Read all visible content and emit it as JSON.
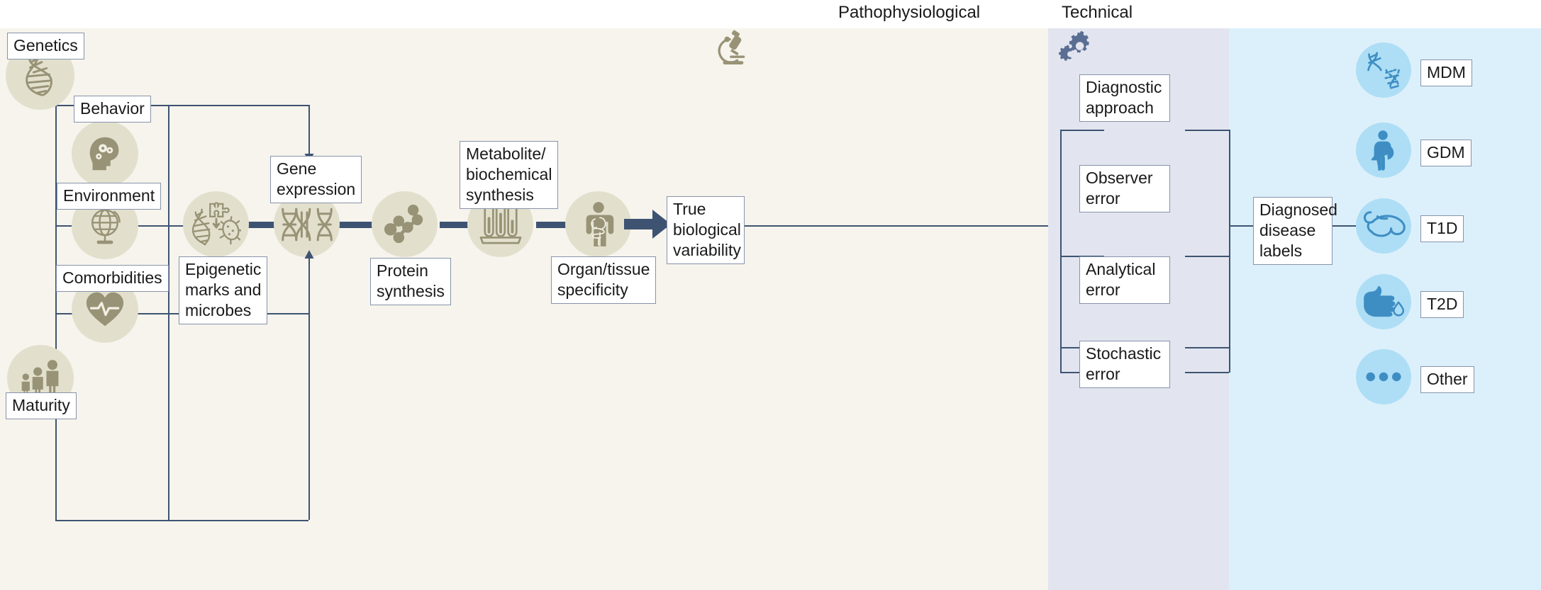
{
  "headers": {
    "pathophysiological": "Pathophysiological",
    "technical": "Technical"
  },
  "colors": {
    "panel_pathophysiological": "#f6f4ec",
    "panel_technical": "#e2e5ef",
    "panel_disease": "#dcf0fb",
    "beige_circle": "#e2e0cd",
    "beige_icon": "#989376",
    "blue_circle": "#addef5",
    "blue_icon": "#3e8ec4",
    "connector": "#3e5372",
    "box_border": "#8793ab",
    "text": "#1a1a1a"
  },
  "determinants": [
    {
      "label": "Genetics",
      "icon": "dna-helix-icon"
    },
    {
      "label": "Behavior",
      "icon": "head-gears-icon"
    },
    {
      "label": "Environment",
      "icon": "globe-icon"
    },
    {
      "label": "Comorbidities",
      "icon": "heart-pulse-icon"
    },
    {
      "label": "Maturity",
      "icon": "family-growth-icon"
    }
  ],
  "pathway": [
    {
      "label": "Epigenetic\nmarks and\nmicrobes",
      "icon": "dna-puzzle-microbe-icon"
    },
    {
      "label": "Gene\nexpression",
      "icon": "dna-double-helix-icon"
    },
    {
      "label": "Protein\nsynthesis",
      "icon": "molecule-icon"
    },
    {
      "label": "Metabolite/\nbiochemical\nsynthesis",
      "icon": "test-tubes-icon"
    },
    {
      "label": "Organ/tissue\nspecificity",
      "icon": "human-organs-icon"
    }
  ],
  "outcome": {
    "label": "True\nbiological\nvariability"
  },
  "technical": {
    "icon": "gears-icon",
    "items": [
      {
        "label": "Diagnostic\napproach"
      },
      {
        "label": "Observer\nerror"
      },
      {
        "label": "Analytical\nerror"
      },
      {
        "label": "Stochastic\nerror"
      }
    ]
  },
  "patho_icon": "microscope-icon",
  "diagnosed": {
    "label": "Diagnosed\ndisease\nlabels"
  },
  "diseases": [
    {
      "label": "MDM",
      "icon": "dna-broken-icon"
    },
    {
      "label": "GDM",
      "icon": "pregnant-woman-icon"
    },
    {
      "label": "T1D",
      "icon": "pancreas-icon"
    },
    {
      "label": "T2D",
      "icon": "finger-blood-drop-icon"
    },
    {
      "label": "Other",
      "icon": "ellipsis-icon"
    }
  ]
}
